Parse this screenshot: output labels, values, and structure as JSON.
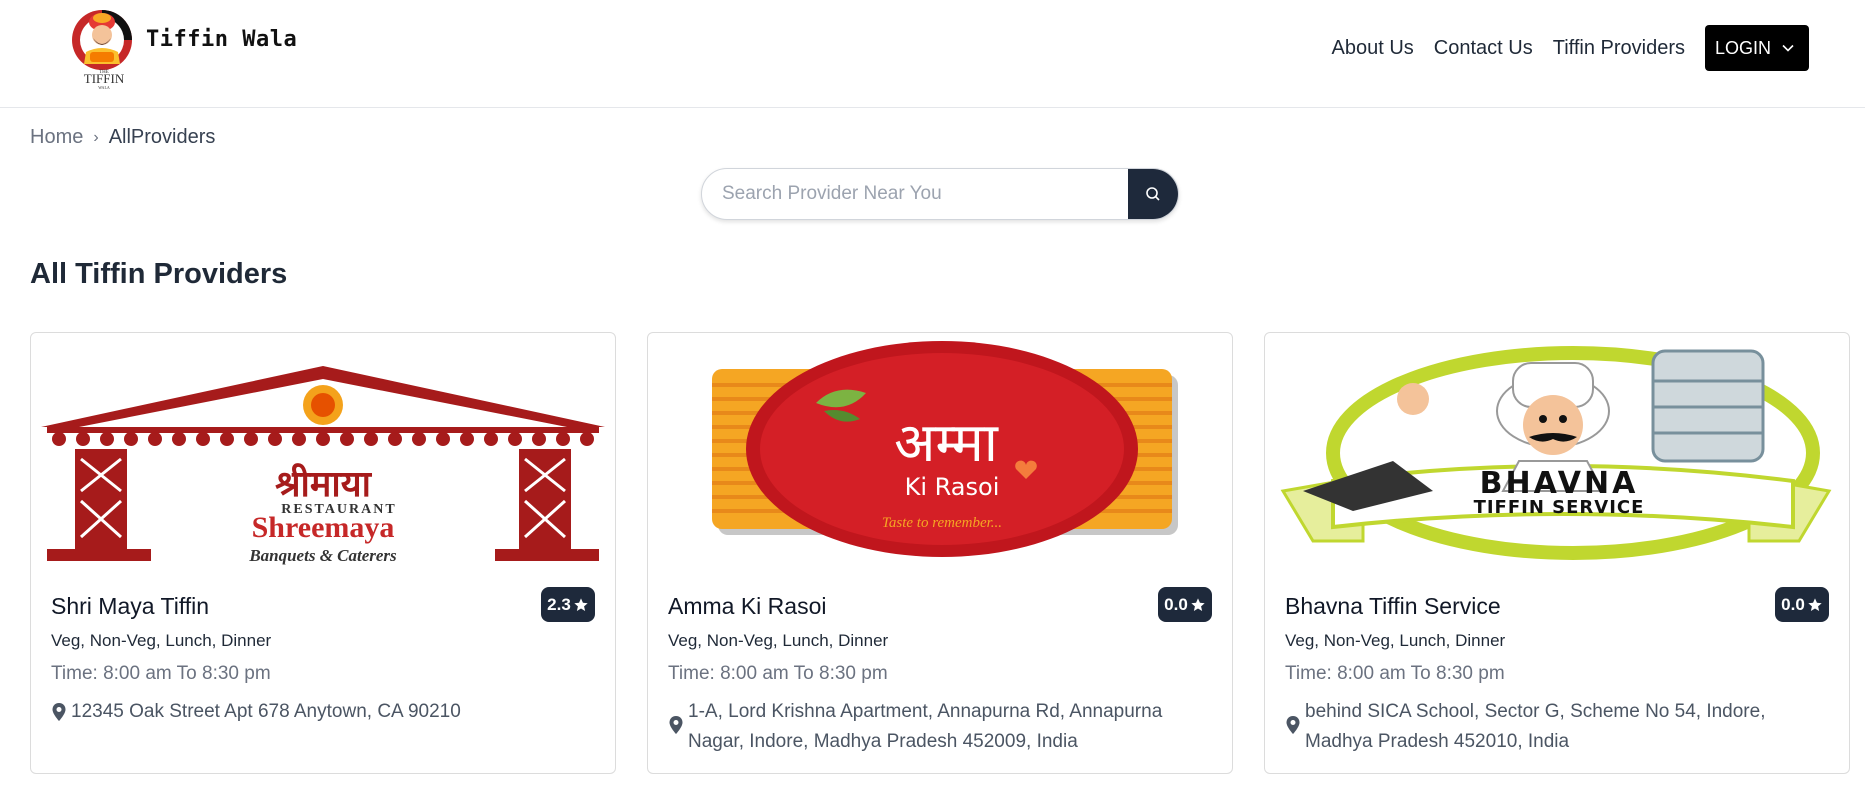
{
  "brand": {
    "name": "Tiffin Wala",
    "logo_text": "THE TIFFIN WALA"
  },
  "nav": {
    "links": [
      {
        "label": "About Us"
      },
      {
        "label": "Contact Us"
      },
      {
        "label": "Tiffin Providers"
      }
    ],
    "login_label": "LOGIN"
  },
  "breadcrumb": {
    "home": "Home",
    "separator": "›",
    "current": "AllProviders"
  },
  "search": {
    "placeholder": "Search Provider Near You",
    "value": ""
  },
  "section_title": "All Tiffin Providers",
  "colors": {
    "dark_navy": "#1e293b",
    "brand_red": "#b91c1c",
    "muted_text": "#6b7280"
  },
  "providers": [
    {
      "name": "Shri Maya Tiffin",
      "rating": "2.3",
      "categories": "Veg, Non-Veg, Lunch, Dinner",
      "time": "Time: 8:00 am To 8:30 pm",
      "address": "12345 Oak Street Apt 678 Anytown, CA 90210",
      "image": {
        "devanagari": "श्रीमाया",
        "sub": "RESTAURANT",
        "name": "Shreemaya",
        "tagline": "Banquets & Caterers"
      }
    },
    {
      "name": "Amma Ki Rasoi",
      "rating": "0.0",
      "categories": "Veg, Non-Veg, Lunch, Dinner",
      "time": "Time: 8:00 am To 8:30 pm",
      "address": "1-A, Lord Krishna Apartment, Annapurna Rd, Annapurna Nagar, Indore, Madhya Pradesh 452009, India",
      "image": {
        "devanagari": "अम्मा",
        "name": "Ki Rasoi",
        "tagline": "Taste to remember..."
      }
    },
    {
      "name": "Bhavna Tiffin Service",
      "rating": "0.0",
      "categories": "Veg, Non-Veg, Lunch, Dinner",
      "time": "Time: 8:00 am To 8:30 pm",
      "address": "behind SICA School, Sector G, Scheme No 54, Indore, Madhya Pradesh 452010, India",
      "image": {
        "line1": "BHAVNA",
        "line2": "TIFFIN SERVICE"
      }
    }
  ]
}
